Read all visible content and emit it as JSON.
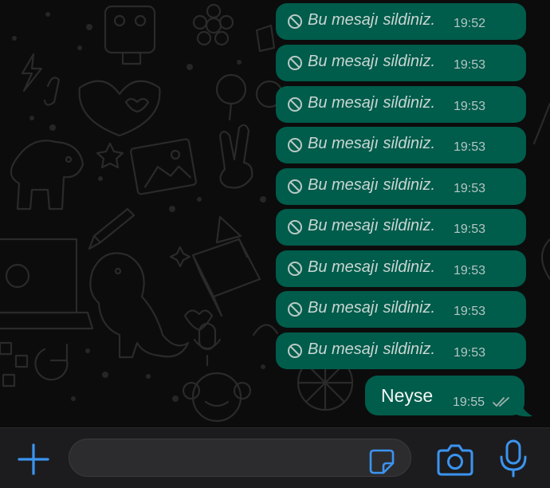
{
  "chat": {
    "deleted_messages": [
      {
        "text": "Bu mesajı sildiniz.",
        "time": "19:52"
      },
      {
        "text": "Bu mesajı sildiniz.",
        "time": "19:53"
      },
      {
        "text": "Bu mesajı sildiniz.",
        "time": "19:53"
      },
      {
        "text": "Bu mesajı sildiniz.",
        "time": "19:53"
      },
      {
        "text": "Bu mesajı sildiniz.",
        "time": "19:53"
      },
      {
        "text": "Bu mesajı sildiniz.",
        "time": "19:53"
      },
      {
        "text": "Bu mesajı sildiniz.",
        "time": "19:53"
      },
      {
        "text": "Bu mesajı sildiniz.",
        "time": "19:53"
      },
      {
        "text": "Bu mesajı sildiniz.",
        "time": "19:53"
      }
    ],
    "last_message": {
      "text": "Neyse",
      "time": "19:55",
      "status_icon": "double-check-icon"
    }
  },
  "composer": {
    "input_value": "",
    "add_icon": "plus-icon",
    "sticker_icon": "sticker-icon",
    "camera_icon": "camera-icon",
    "mic_icon": "microphone-icon"
  },
  "colors": {
    "outgoing_bubble": "#005c4b",
    "accent": "#3b94f0",
    "background": "#0c0c0c"
  }
}
